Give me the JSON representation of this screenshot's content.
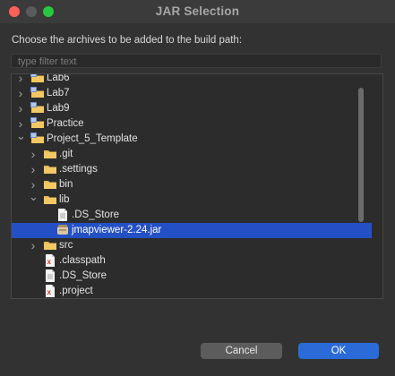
{
  "window": {
    "title": "JAR Selection"
  },
  "instruction": "Choose the archives to be added to the build path:",
  "filter": {
    "placeholder": "type filter text"
  },
  "tree": [
    {
      "label": "Lab6",
      "icon": "project-folder-icon",
      "chevron": "right"
    },
    {
      "label": "Lab7",
      "icon": "project-folder-icon",
      "chevron": "right"
    },
    {
      "label": "Lab9",
      "icon": "project-folder-icon",
      "chevron": "right"
    },
    {
      "label": "Practice",
      "icon": "project-folder-icon",
      "chevron": "right"
    },
    {
      "label": "Project_5_Template",
      "icon": "project-folder-icon",
      "chevron": "down"
    },
    {
      "label": ".git",
      "icon": "folder-icon",
      "chevron": "right"
    },
    {
      "label": ".settings",
      "icon": "folder-icon",
      "chevron": "right"
    },
    {
      "label": "bin",
      "icon": "folder-icon",
      "chevron": "right"
    },
    {
      "label": "lib",
      "icon": "folder-icon",
      "chevron": "down"
    },
    {
      "label": ".DS_Store",
      "icon": "file-icon",
      "chevron": ""
    },
    {
      "label": "jmapviewer-2.24.jar",
      "icon": "jar-icon",
      "chevron": "",
      "selected": true
    },
    {
      "label": "src",
      "icon": "folder-icon",
      "chevron": "right"
    },
    {
      "label": ".classpath",
      "icon": "xml-file-icon",
      "chevron": ""
    },
    {
      "label": ".DS_Store",
      "icon": "file-icon",
      "chevron": ""
    },
    {
      "label": ".project",
      "icon": "xml-file-icon",
      "chevron": ""
    }
  ],
  "buttons": {
    "cancel": "Cancel",
    "ok": "OK"
  },
  "colors": {
    "selection": "#2450c5",
    "ok_button": "#2a6bd8",
    "folder": "#e8b84e"
  }
}
